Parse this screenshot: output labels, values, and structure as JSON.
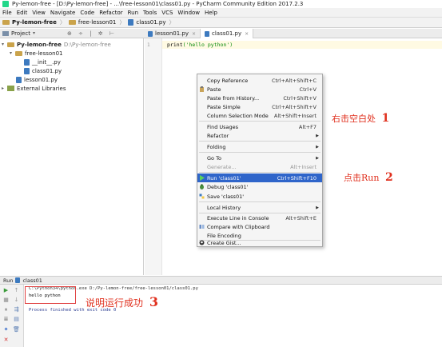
{
  "window": {
    "title": "Py-lemon-free - [D:\\Py-lemon-free] - ...\\free-lesson01\\class01.py - PyCharm Community Edition 2017.2.3"
  },
  "menu": [
    "File",
    "Edit",
    "View",
    "Navigate",
    "Code",
    "Refactor",
    "Run",
    "Tools",
    "VCS",
    "Window",
    "Help"
  ],
  "breadcrumb": [
    "Py-lemon-free",
    "free-lesson01",
    "class01.py"
  ],
  "project_panel": {
    "label": "Project",
    "dropdown": "▾",
    "tools": "⊕ ÷ | ✲ ⊢"
  },
  "tabs": [
    {
      "label": "lesson01.py",
      "close": "×"
    },
    {
      "label": "class01.py",
      "close": "×"
    }
  ],
  "tree": {
    "root": {
      "name": "Py-lemon-free",
      "path": "D:\\Py-lemon-free"
    },
    "folder": "free-lesson01",
    "files": [
      "__init__.py",
      "class01.py"
    ],
    "root_file": "lesson01.py",
    "libs": "External Libraries"
  },
  "editor": {
    "line_number": "1",
    "code_fn": "print",
    "code_str": "('hello python')"
  },
  "context_menu": [
    {
      "label": "Copy Reference",
      "shortcut": "Ctrl+Alt+Shift+C"
    },
    {
      "label": "Paste",
      "shortcut": "Ctrl+V"
    },
    {
      "label": "Paste from History...",
      "shortcut": "Ctrl+Shift+V"
    },
    {
      "label": "Paste Simple",
      "shortcut": "Ctrl+Alt+Shift+V"
    },
    {
      "label": "Column Selection Mode",
      "shortcut": "Alt+Shift+Insert"
    },
    {
      "label": "Find Usages",
      "shortcut": "Alt+F7"
    },
    {
      "label": "Refactor",
      "shortcut": ""
    },
    {
      "label": "Folding",
      "shortcut": ""
    },
    {
      "label": "Go To",
      "shortcut": ""
    },
    {
      "label": "Generate...",
      "shortcut": "Alt+Insert"
    },
    {
      "label": "Run 'class01'",
      "shortcut": "Ctrl+Shift+F10"
    },
    {
      "label": "Debug 'class01'",
      "shortcut": ""
    },
    {
      "label": "Save 'class01'",
      "shortcut": ""
    },
    {
      "label": "Local History",
      "shortcut": ""
    },
    {
      "label": "Execute Line in Console",
      "shortcut": "Alt+Shift+E"
    },
    {
      "label": "Compare with Clipboard",
      "shortcut": ""
    },
    {
      "label": "File Encoding",
      "shortcut": ""
    },
    {
      "label": "Create Gist...",
      "shortcut": ""
    }
  ],
  "annotations": {
    "a1": "右击空白处",
    "a1_num": "1",
    "a2": "点击Run",
    "a2_num": "2",
    "a3": "说明运行成功",
    "a3_num": "3"
  },
  "run_panel": {
    "label": "Run",
    "config": "class01",
    "console": {
      "cmd": "C:\\Python34\\python.exe D:/Py-lemon-free/free-lesson01/class01.py",
      "output": "hello python",
      "finished": "Process finished with exit code 0"
    }
  },
  "colors": {
    "highlight": "#2f65ca",
    "annotation": "#e0301e",
    "run_green": "#3a9b3a"
  }
}
